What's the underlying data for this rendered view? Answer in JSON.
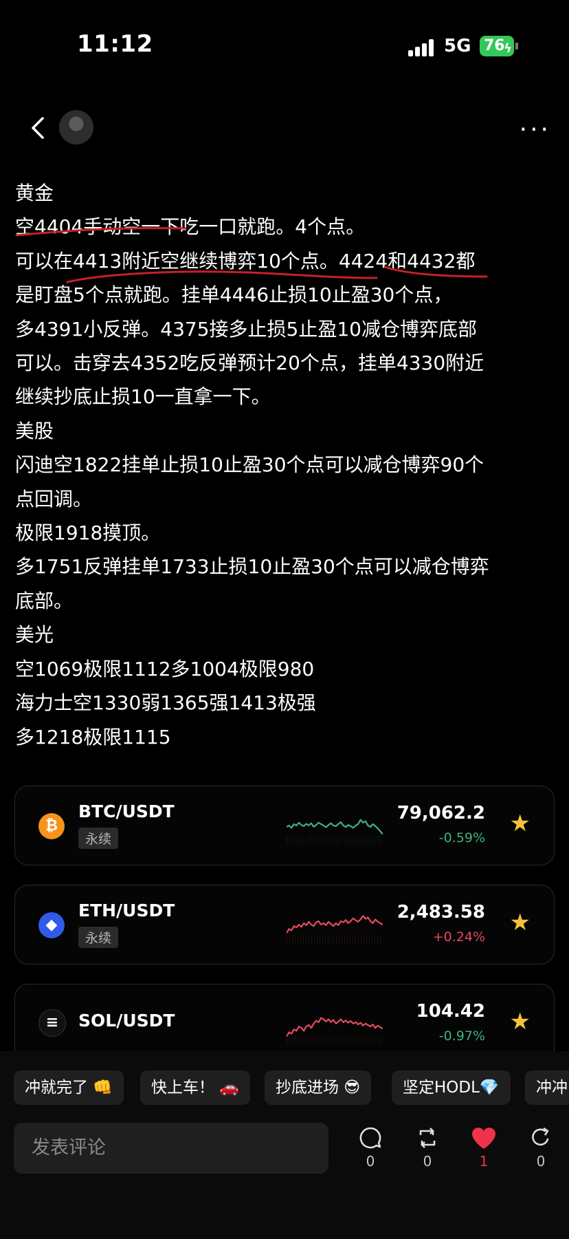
{
  "status_bar": {
    "time": "11:12",
    "network": "5G",
    "battery": "76"
  },
  "post": {
    "lines": [
      "黄金",
      "空4404手动空一下吃一口就跑。4个点。",
      "可以在4413附近空继续博弈10个点。4424和4432都",
      "是盯盘5个点就跑。挂单4446止损10止盈30个点，",
      "多4391小反弹。4375接多止损5止盈10减仓博弈底部",
      "可以。击穿去4352吃反弹预计20个点，挂单4330附近",
      "继续抄底止损10一直拿一下。",
      "美股",
      "闪迪空1822挂单止损10止盈30个点可以减仓博弈90个",
      "点回调。",
      "极限1918摸顶。",
      "多1751反弹挂单1733止损10止盈30个点可以减仓博弈",
      "底部。",
      "美光",
      "空1069极限1112多1004极限980",
      "海力士空1330弱1365强1413极强",
      "多1218极限1115"
    ]
  },
  "tickers": [
    {
      "pair": "BTC/USDT",
      "tag": "永续",
      "price": "79,062.2",
      "change": "-0.59%",
      "trend": "down",
      "coin_color": "#f7931a",
      "coin_symbol": "₿",
      "spark_color": "#3fb27f",
      "spark": [
        0.45,
        0.5,
        0.42,
        0.55,
        0.5,
        0.6,
        0.52,
        0.48,
        0.56,
        0.5,
        0.58,
        0.46,
        0.52,
        0.6,
        0.55,
        0.5,
        0.44,
        0.52,
        0.58,
        0.5,
        0.48,
        0.55,
        0.62,
        0.5,
        0.45,
        0.52,
        0.48,
        0.42,
        0.5,
        0.55,
        0.7,
        0.6,
        0.65,
        0.5,
        0.45,
        0.55,
        0.48,
        0.4,
        0.3,
        0.2
      ]
    },
    {
      "pair": "ETH/USDT",
      "tag": "永续",
      "price": "2,483.58",
      "change": "+0.24%",
      "trend": "up",
      "coin_color": "#2f5be8",
      "coin_symbol": "◆",
      "spark_color": "#e44b5e",
      "spark": [
        0.2,
        0.35,
        0.3,
        0.45,
        0.4,
        0.5,
        0.42,
        0.55,
        0.48,
        0.6,
        0.5,
        0.45,
        0.58,
        0.62,
        0.5,
        0.55,
        0.48,
        0.6,
        0.52,
        0.45,
        0.55,
        0.48,
        0.62,
        0.58,
        0.66,
        0.55,
        0.62,
        0.72,
        0.65,
        0.6,
        0.68,
        0.8,
        0.7,
        0.75,
        0.62,
        0.55,
        0.68,
        0.6,
        0.55,
        0.5
      ]
    },
    {
      "pair": "SOL/USDT",
      "tag": "",
      "price": "104.42",
      "change": "-0.97%",
      "trend": "down",
      "coin_color": "#111111",
      "coin_symbol": "≡",
      "spark_color": "#e44b5e",
      "spark": [
        0.1,
        0.25,
        0.2,
        0.35,
        0.3,
        0.45,
        0.4,
        0.3,
        0.45,
        0.5,
        0.4,
        0.55,
        0.65,
        0.6,
        0.75,
        0.7,
        0.62,
        0.7,
        0.6,
        0.68,
        0.55,
        0.62,
        0.7,
        0.6,
        0.66,
        0.58,
        0.64,
        0.55,
        0.6,
        0.52,
        0.58,
        0.48,
        0.55,
        0.5,
        0.45,
        0.52,
        0.4,
        0.48,
        0.42,
        0.38
      ]
    }
  ],
  "quick_replies": [
    "冲就完了 👊",
    "快上车！ 🚗",
    "抄底进场 😎",
    "坚定HODL💎",
    "冲冲"
  ],
  "comment_placeholder": "发表评论",
  "actions": [
    {
      "name": "comment",
      "count": "0"
    },
    {
      "name": "repost",
      "count": "0"
    },
    {
      "name": "like",
      "count": "1"
    },
    {
      "name": "share",
      "count": "0"
    }
  ]
}
